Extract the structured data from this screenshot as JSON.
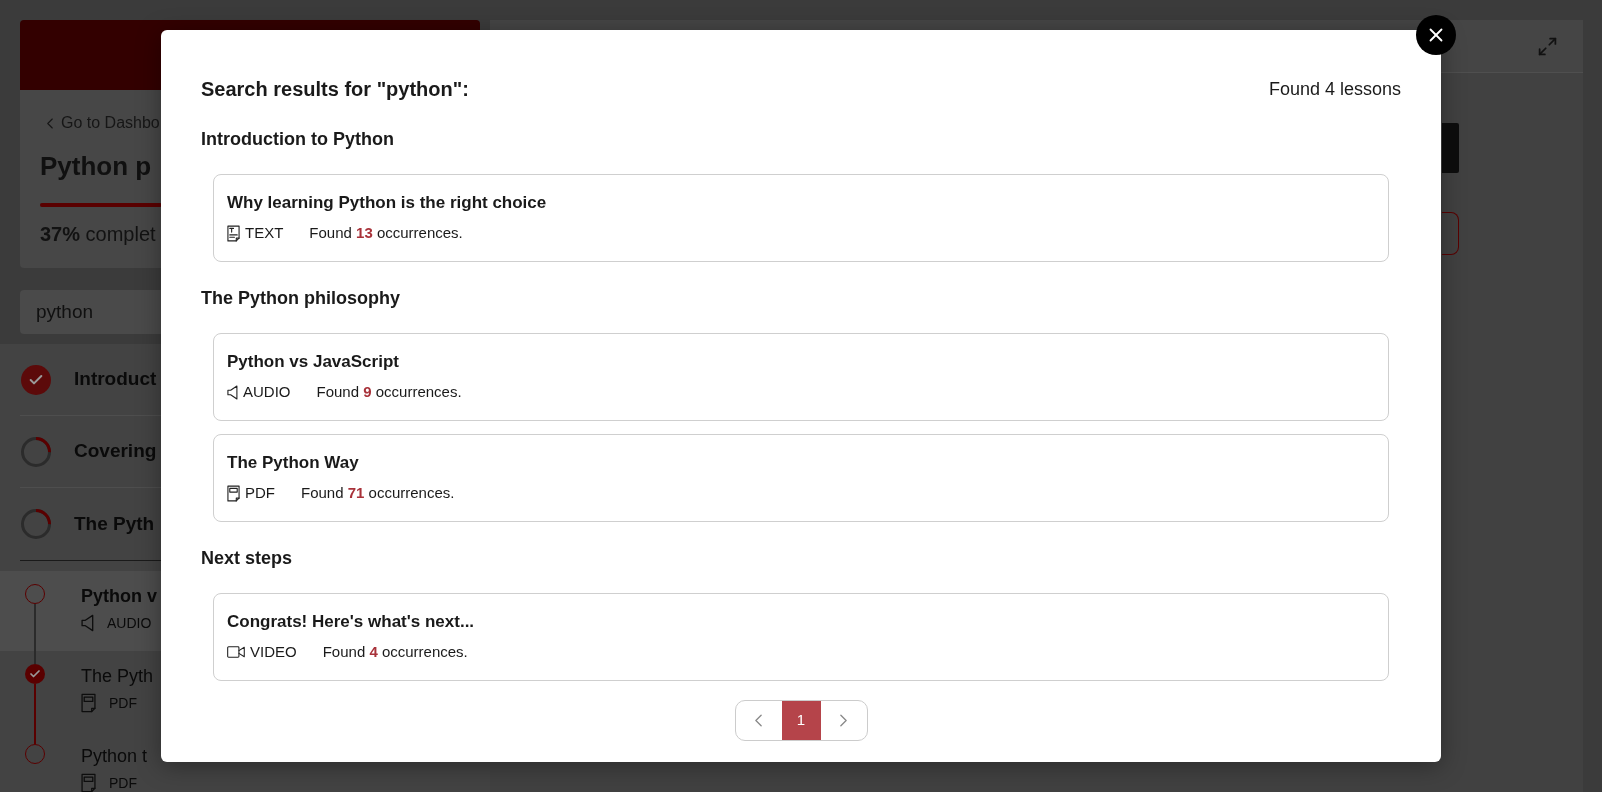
{
  "sidebar": {
    "back_link": "Go to Dashbo",
    "course_title": "Python p",
    "progress": {
      "level": 0.37,
      "label": "**37%** complet"
    },
    "search": {
      "value": "python"
    },
    "sections": [
      {
        "title": "Introduct",
        "completed": true
      },
      {
        "title": "Covering",
        "completed": false
      },
      {
        "title": "The Pyth",
        "completed": false
      }
    ],
    "lessons": [
      {
        "title": "Python v",
        "kind": "audio",
        "type": "AUDIO",
        "selected": true,
        "completed": false
      },
      {
        "title": "The Pyth",
        "kind": "pdf",
        "type": "PDF",
        "selected": false,
        "completed": true
      },
      {
        "title": "Python t",
        "kind": "pdf",
        "type": "PDF",
        "selected": false,
        "completed": false
      }
    ]
  },
  "modal": {
    "title": "Search results for \"python\":",
    "count": "Found 4 lessons",
    "groups": [
      {
        "heading": "Introduction to Python",
        "results": [
          {
            "title": "Why learning Python is the right choice",
            "kind": "text",
            "type": "TEXT",
            "found": "Found **13** occurrences."
          }
        ]
      },
      {
        "heading": "The Python philosophy",
        "results": [
          {
            "title": "Python vs JavaScript",
            "kind": "audio",
            "type": "AUDIO",
            "found": "Found **9** occurrences."
          },
          {
            "title": "The Python Way",
            "kind": "pdf",
            "type": "PDF",
            "found": "Found **71** occurrences."
          }
        ]
      },
      {
        "heading": "Next steps",
        "results": [
          {
            "title": "Congrats! Here's what's next...",
            "kind": "video",
            "type": "VIDEO",
            "found": "Found **4** occurrences."
          }
        ]
      }
    ],
    "pagination": {
      "pages": [
        {
          "label": "1",
          "selected": true
        }
      ]
    }
  }
}
